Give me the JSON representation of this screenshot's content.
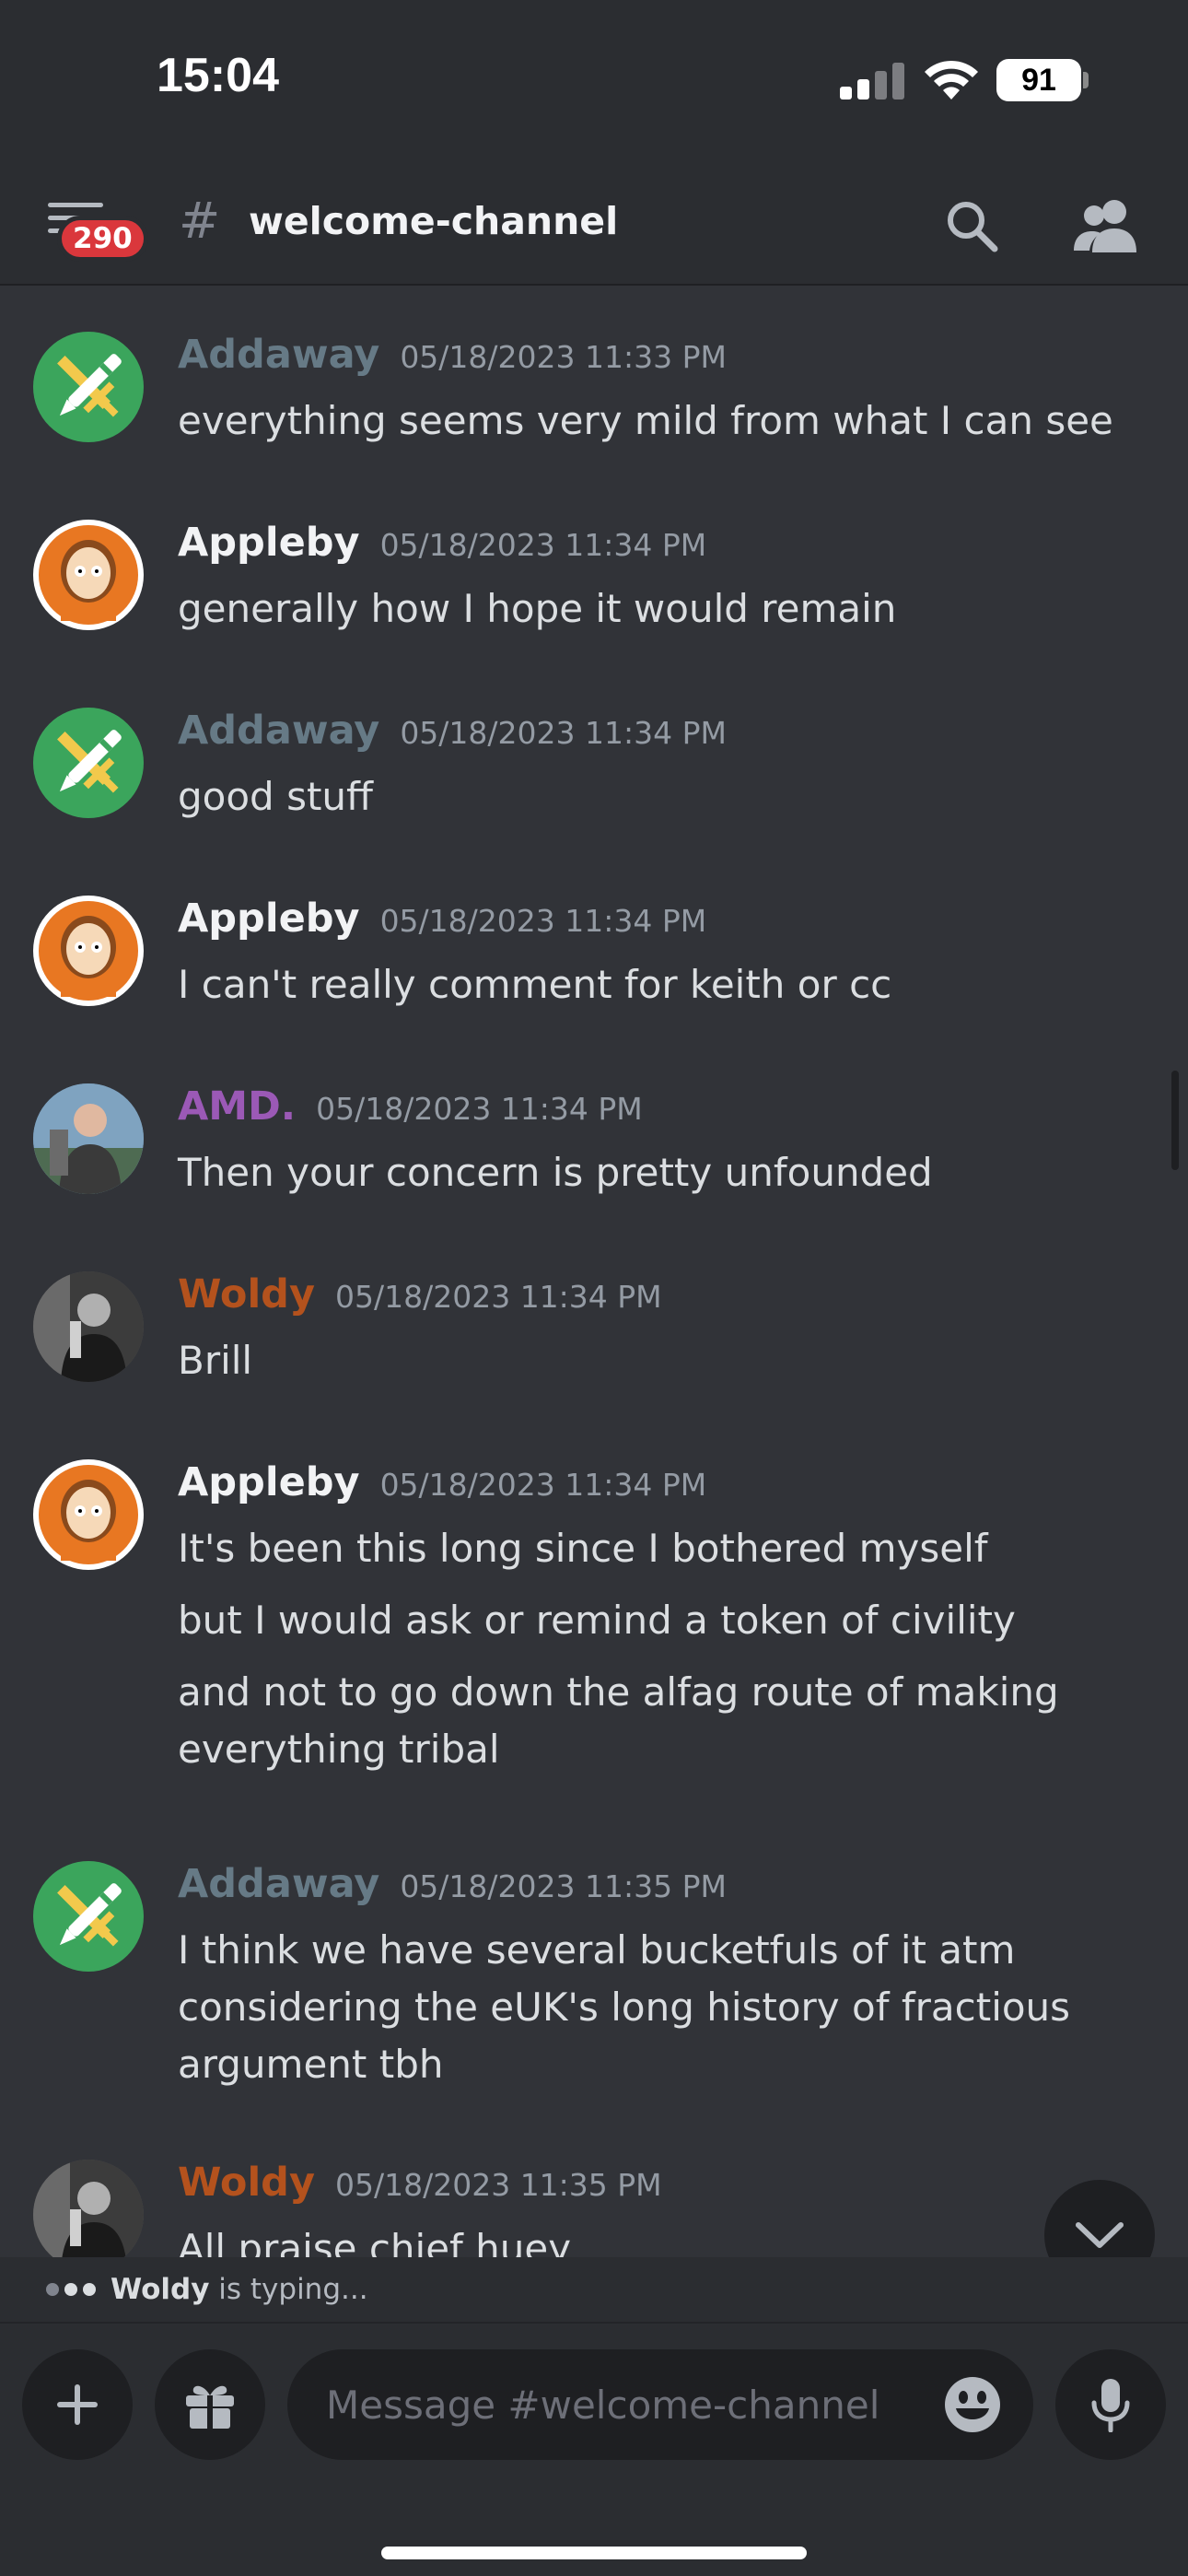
{
  "status_bar": {
    "time": "15:04",
    "battery": "91"
  },
  "header": {
    "badge": "290",
    "channel": "welcome-channel"
  },
  "messages": [
    {
      "author": "Addaway",
      "color": "#667a86",
      "avatar": "pen-sword",
      "time": "05/18/2023 11:33 PM",
      "lines": [
        "everything seems very mild from what I can see"
      ]
    },
    {
      "author": "Appleby",
      "color": "#f2f3f5",
      "avatar": "orange-hood",
      "time": "05/18/2023 11:34 PM",
      "lines": [
        "generally how I hope it would remain"
      ]
    },
    {
      "author": "Addaway",
      "color": "#667a86",
      "avatar": "pen-sword",
      "time": "05/18/2023 11:34 PM",
      "lines": [
        "good stuff"
      ]
    },
    {
      "author": "Appleby",
      "color": "#f2f3f5",
      "avatar": "orange-hood",
      "time": "05/18/2023 11:34 PM",
      "lines": [
        "I can't really comment for keith or cc"
      ]
    },
    {
      "author": "AMD.",
      "color": "#9b59b6",
      "avatar": "photo-man",
      "time": "05/18/2023 11:34 PM",
      "lines": [
        "Then your concern is pretty unfounded"
      ]
    },
    {
      "author": "Woldy",
      "color": "#b4521d",
      "avatar": "bw-photo",
      "time": "05/18/2023 11:34 PM",
      "lines": [
        "Brill"
      ]
    },
    {
      "author": "Appleby",
      "color": "#f2f3f5",
      "avatar": "orange-hood",
      "time": "05/18/2023 11:34 PM",
      "lines": [
        "It's been this long since I bothered myself",
        "but I would ask or remind a token of civility",
        "and not to go down the alfag route of making everything tribal"
      ]
    },
    {
      "author": "Addaway",
      "color": "#667a86",
      "avatar": "pen-sword",
      "time": "05/18/2023 11:35 PM",
      "lines": [
        "I think we have several bucketfuls of it atm considering the eUK's long history of fractious argument tbh"
      ]
    },
    {
      "author": "Woldy",
      "color": "#b4521d",
      "avatar": "bw-photo",
      "time": "05/18/2023 11:35 PM",
      "lines": [
        "All praise chief huey"
      ]
    }
  ],
  "typing": {
    "user": "Woldy",
    "text": " is typing..."
  },
  "composer": {
    "placeholder": "Message #welcome-channel"
  },
  "icons": [
    "hamburger-icon",
    "hash-icon",
    "search-icon",
    "members-icon",
    "chevron-down-icon",
    "plus-icon",
    "gift-icon",
    "emoji-icon",
    "microphone-icon"
  ]
}
